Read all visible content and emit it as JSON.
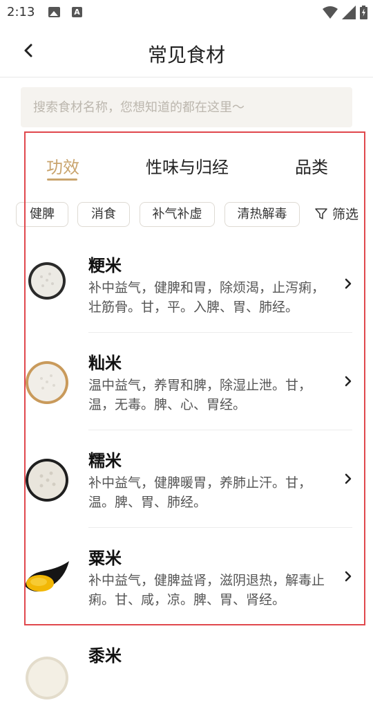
{
  "status": {
    "time": "2:13"
  },
  "header": {
    "title": "常见食材"
  },
  "search": {
    "placeholder": "搜索食材名称，您想知道的都在这里～"
  },
  "tabs": [
    {
      "label": "功效",
      "active": true
    },
    {
      "label": "性味与归经",
      "active": false
    },
    {
      "label": "品类",
      "active": false
    }
  ],
  "chips": [
    "健脾",
    "消食",
    "补气补虚",
    "清热解毒"
  ],
  "filter": {
    "label": "筛选"
  },
  "items": [
    {
      "name": "粳米",
      "desc": "补中益气，健脾和胃，除烦渴，止泻痢，壮筋骨。甘，平。入脾、胃、肺经。"
    },
    {
      "name": "籼米",
      "desc": "温中益气，养胃和脾，除湿止泄。甘，温，无毒。脾、心、胃经。"
    },
    {
      "name": "糯米",
      "desc": "补中益气，健脾暖胃，养肺止汗。甘，温。脾、胃、肺经。"
    },
    {
      "name": "粟米",
      "desc": "补中益气，健脾益肾，滋阴退热，解毒止痢。甘、咸，凉。脾、胃、肾经。"
    },
    {
      "name": "黍米",
      "desc": ""
    }
  ],
  "colors": {
    "accent": "#c9a46d",
    "highlight_border": "#e0474c"
  }
}
